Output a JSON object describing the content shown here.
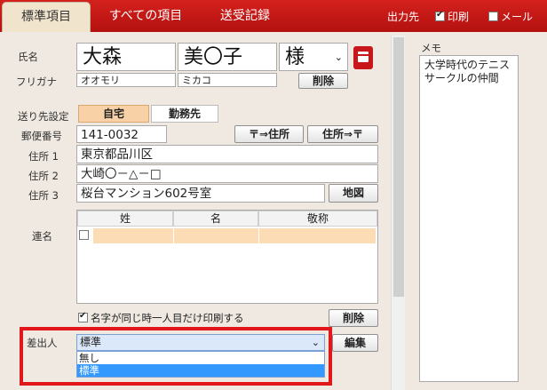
{
  "tabs": [
    {
      "label": "標準項目"
    },
    {
      "label": "すべての項目"
    },
    {
      "label": "送受記録"
    }
  ],
  "topright": {
    "output_label": "出力先",
    "print_label": "印刷",
    "mail_label": "メール"
  },
  "name": {
    "label": "氏名",
    "last": "大森",
    "first": "美〇子",
    "honorific": "様",
    "kana_label": "フリガナ",
    "kana_last": "オオモリ",
    "kana_first": "ミカコ",
    "delete_label": "削除"
  },
  "address": {
    "dest_label": "送り先設定",
    "home_label": "自宅",
    "work_label": "勤務先",
    "zip_label": "郵便番号",
    "zip": "141-0032",
    "zip_to_addr": "〒⇒住所",
    "addr_to_zip": "住所⇒〒",
    "addr1_label": "住所 1",
    "addr1": "東京都品川区",
    "addr2_label": "住所 2",
    "addr2": "大崎〇－△－□",
    "addr3_label": "住所 3",
    "addr3": "桜台マンション602号室",
    "map_label": "地図"
  },
  "joint": {
    "label": "連名",
    "col_last": "姓",
    "col_first": "名",
    "col_honorific": "敬称",
    "note": "名字が同じ時一人目だけ印刷する",
    "delete_label": "削除"
  },
  "sender": {
    "label": "差出人",
    "selected": "標準",
    "options": [
      "無し",
      "標準"
    ],
    "edit_label": "編集"
  },
  "memo": {
    "label": "メモ",
    "text": "大学時代のテニスサークルの仲間"
  },
  "colors": {
    "accent": "#c8161b",
    "tab_active": "#f1e4cd",
    "highlight_row": "#fbdcb5",
    "select_highlight": "#3399ff"
  }
}
